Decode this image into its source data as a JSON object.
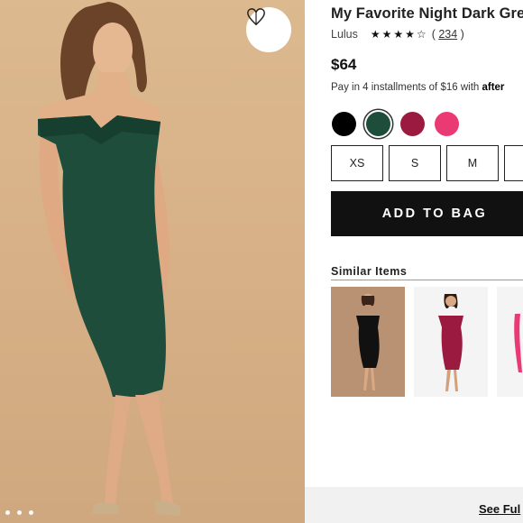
{
  "product": {
    "title": "My Favorite Night Dark Green",
    "brand": "Lulus",
    "stars_text": "★★★★☆",
    "rating": 4.5,
    "review_count_prefix": "( ",
    "review_count": "234",
    "review_count_suffix": " )",
    "price": "$64",
    "installments_text": "Pay in 4 installments of $16 with ",
    "installments_provider": "after"
  },
  "colors": [
    {
      "name": "black",
      "hex": "#000000",
      "selected": false
    },
    {
      "name": "dark-green",
      "hex": "#1e4d3b",
      "selected": true
    },
    {
      "name": "burgundy",
      "hex": "#9b1b40",
      "selected": false
    },
    {
      "name": "pink",
      "hex": "#e93a74",
      "selected": false
    }
  ],
  "sizes": [
    "XS",
    "S",
    "M"
  ],
  "actions": {
    "add_to_bag": "ADD TO BAG",
    "see_full": "See Ful"
  },
  "similar": {
    "heading": "Similar Items"
  },
  "gallery": {
    "dot_count": 3,
    "favorite_icon": "heart-icon"
  },
  "palette": {
    "photo_bg": "#d8b188",
    "dress_green": "#1e4d3b",
    "button_black": "#111111"
  }
}
